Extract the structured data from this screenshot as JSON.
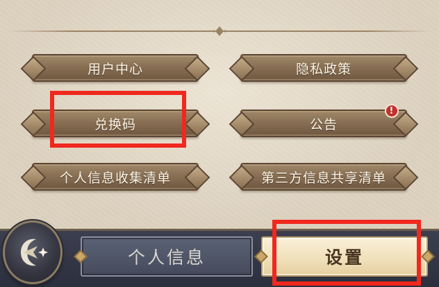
{
  "menu": {
    "user_center": "用户中心",
    "privacy_policy": "隐私政策",
    "redeem_code": "兑换码",
    "announcement": "公告",
    "personal_info_list": "个人信息收集清单",
    "third_party_list": "第三方信息共享清单"
  },
  "announcement_badge": "!",
  "tabs": {
    "profile": "个人信息",
    "settings": "设置"
  },
  "icons": {
    "back": "crescent-sparkle-icon",
    "badge": "alert-icon"
  },
  "colors": {
    "highlight": "#f0281e",
    "button_brown": "#866d52",
    "parchment": "#ddd2c0",
    "bar": "#2c2f3d",
    "active_tab": "#f0dfb9"
  }
}
